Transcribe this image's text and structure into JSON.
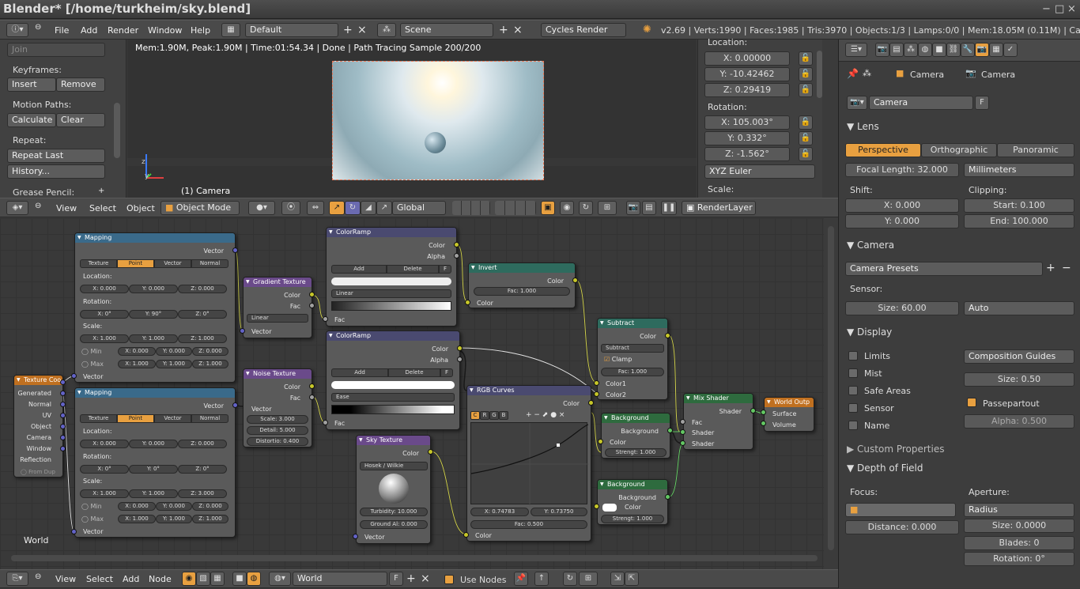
{
  "title": "Blender* [/home/turkheim/sky.blend]",
  "window_buttons": [
    "−",
    "□",
    "×"
  ],
  "menu": {
    "file": "File",
    "add": "Add",
    "render": "Render",
    "window": "Window",
    "help": "Help"
  },
  "layout": {
    "screen": "Default",
    "scene": "Scene",
    "engine": "Cycles Render"
  },
  "stats": "v2.69 | Verts:1990 | Faces:1985 | Tris:3970 | Objects:1/3 | Lamps:0/0 | Mem:18.05M (0.11M) | Camera",
  "toolshelf": {
    "join": "Join",
    "keyframes": "Keyframes:",
    "insert": "Insert",
    "remove": "Remove",
    "motion_paths": "Motion Paths:",
    "calculate": "Calculate",
    "clear": "Clear",
    "repeat": "Repeat:",
    "repeat_last": "Repeat Last",
    "history": "History...",
    "grease_pencil": "Grease Pencil:"
  },
  "viewport": {
    "info": "Mem:1.90M, Peak:1.90M | Time:01:54.34 | Done | Path Tracing Sample 200/200",
    "camera_label": "(1) Camera",
    "axis_z": "z",
    "axis_y": "y"
  },
  "transform": {
    "location": "Location:",
    "x": "X: 0.00000",
    "y": "Y: -10.42462",
    "z": "Z: 0.29419",
    "rotation": "Rotation:",
    "rx": "X: 105.003°",
    "ry": "Y: 0.332°",
    "rz": "Z: -1.562°",
    "mode": "XYZ Euler",
    "scale": "Scale:"
  },
  "view3d_header": {
    "view": "View",
    "select": "Select",
    "object": "Object",
    "mode": "Object Mode",
    "orientation": "Global",
    "render_layer": "RenderLayer"
  },
  "node_header": {
    "view": "View",
    "select": "Select",
    "add": "Add",
    "node": "Node",
    "world": "World",
    "f": "F",
    "use_nodes": "Use Nodes"
  },
  "node_editor": {
    "world_label": "World"
  },
  "nodes": {
    "texcoord": {
      "title": "Texture Coo",
      "outputs": [
        "Generated",
        "Normal",
        "UV",
        "Object",
        "Camera",
        "Window",
        "Reflection"
      ],
      "from_dup": "From Dup"
    },
    "mapping1": {
      "title": "Mapping",
      "vector": "Vector",
      "tabs": [
        "Texture",
        "Point",
        "Vector",
        "Normal"
      ],
      "location": "Location:",
      "lx": "X: 0.000",
      "ly": "Y: 0.000",
      "lz": "Z: 0.000",
      "rotation": "Rotation:",
      "rx": "X: 0°",
      "ry": "Y: 90°",
      "rz": "Z: 0°",
      "scale": "Scale:",
      "sx": "X: 1.000",
      "sy": "Y: 1.000",
      "sz": "Z: 1.000",
      "min": "Min",
      "max": "Max",
      "minx": "X: 0.000",
      "miny": "Y: 0.000",
      "minz": "Z: 0.000",
      "maxx": "X: 1.000",
      "maxy": "Y: 1.000",
      "maxz": "Z: 1.000",
      "vector_in": "Vector"
    },
    "mapping2": {
      "title": "Mapping",
      "vector": "Vector",
      "tabs": [
        "Texture",
        "Point",
        "Vector",
        "Normal"
      ],
      "location": "Location:",
      "lx": "X: 0.000",
      "ly": "Y: 0.000",
      "lz": "Z: 0.000",
      "rotation": "Rotation:",
      "rx": "X: 0°",
      "ry": "Y: 0°",
      "rz": "Z: 0°",
      "scale": "Scale:",
      "sx": "X: 1.000",
      "sy": "Y: 1.000",
      "sz": "Z: 3.000",
      "min": "Min",
      "max": "Max",
      "minx": "X: 0.000",
      "miny": "Y: 0.000",
      "minz": "Z: 0.000",
      "maxx": "X: 1.000",
      "maxy": "Y: 1.000",
      "maxz": "Z: 1.000",
      "vector_in": "Vector"
    },
    "gradient": {
      "title": "Gradient Texture",
      "color": "Color",
      "fac": "Fac",
      "type": "Linear",
      "vector": "Vector"
    },
    "noise": {
      "title": "Noise Texture",
      "color": "Color",
      "fac": "Fac",
      "vector": "Vector",
      "scale": "Scale: 3.000",
      "detail": "Detail: 5.000",
      "distortion": "Distortio: 0.400"
    },
    "ramp1": {
      "title": "ColorRamp",
      "color": "Color",
      "alpha": "Alpha",
      "add": "Add",
      "delete": "Delete",
      "f": "F",
      "interp": "Linear",
      "fac": "Fac"
    },
    "ramp2": {
      "title": "ColorRamp",
      "color": "Color",
      "alpha": "Alpha",
      "add": "Add",
      "delete": "Delete",
      "f": "F",
      "interp": "Ease",
      "fac": "Fac"
    },
    "invert": {
      "title": "Invert",
      "color_out": "Color",
      "fac": "Fac: 1.000",
      "color_in": "Color"
    },
    "subtract": {
      "title": "Subtract",
      "color": "Color",
      "op": "Subtract",
      "clamp": "Clamp",
      "fac": "Fac: 1.000",
      "color1": "Color1",
      "color2": "Color2"
    },
    "rgbcurves": {
      "title": "RGB Curves",
      "color": "Color",
      "channels": [
        "C",
        "R",
        "G",
        "B"
      ],
      "x": "X: 0.74783",
      "y": "Y: 0.73750",
      "fac": "Fac: 0.500",
      "color_in": "Color"
    },
    "sky": {
      "title": "Sky Texture",
      "color": "Color",
      "model": "Hosek / Wilkie",
      "turbidity": "Turbidity: 10.000",
      "ground": "Ground Al: 0.000",
      "vector": "Vector"
    },
    "bg1": {
      "title": "Background",
      "background": "Background",
      "color": "Color",
      "strength": "Strengt: 1.000"
    },
    "bg2": {
      "title": "Background",
      "background": "Background",
      "color": "Color",
      "strength": "Strengt: 1.000"
    },
    "mix": {
      "title": "Mix Shader",
      "shader": "Shader",
      "fac": "Fac",
      "s1": "Shader",
      "s2": "Shader"
    },
    "output": {
      "title": "World Outp",
      "surface": "Surface",
      "volume": "Volume"
    }
  },
  "props": {
    "camera_crumb1": "Camera",
    "camera_crumb2": "Camera",
    "datablock": "Camera",
    "f": "F",
    "lens": "Lens",
    "perspective": "Perspective",
    "orthographic": "Orthographic",
    "panoramic": "Panoramic",
    "focal": "Focal Length: 32.000",
    "units": "Millimeters",
    "shift": "Shift:",
    "clipping": "Clipping:",
    "shiftx": "X: 0.000",
    "shifty": "Y: 0.000",
    "start": "Start: 0.100",
    "end": "End: 100.000",
    "camera": "Camera",
    "presets": "Camera Presets",
    "sensor": "Sensor:",
    "size": "Size: 60.00",
    "auto": "Auto",
    "display": "Display",
    "limits": "Limits",
    "mist": "Mist",
    "safe_areas": "Safe Areas",
    "sensor_chk": "Sensor",
    "name": "Name",
    "composition": "Composition Guides",
    "guide_size": "Size: 0.50",
    "passepartout": "Passepartout",
    "alpha": "Alpha: 0.500",
    "custom": "Custom Properties",
    "dof": "Depth of Field",
    "focus": "Focus:",
    "aperture": "Aperture:",
    "distance": "Distance: 0.000",
    "radius": "Radius",
    "ap_size": "Size: 0.0000",
    "blades": "Blades: 0",
    "ap_rotation": "Rotation: 0°"
  },
  "colors": {
    "node_input": "#cc7a1e",
    "node_shader": "#2e6b5e",
    "node_converter": "#3e8a82",
    "node_vector": "#3c5b82",
    "node_color": "#3f3c6b",
    "accent": "#e8a040"
  }
}
